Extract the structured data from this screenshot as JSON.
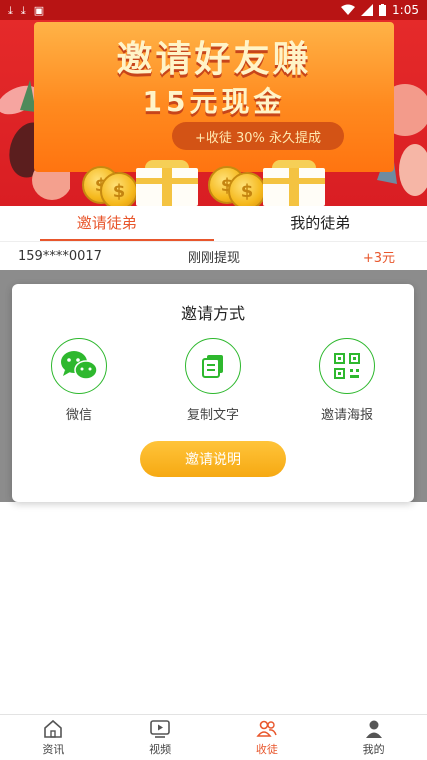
{
  "status_bar": {
    "time": "1:05",
    "left_icons": [
      "download-icon",
      "download-icon",
      "image-icon"
    ],
    "right_icons": [
      "wifi-icon",
      "signal-icon",
      "battery-icon"
    ]
  },
  "banner": {
    "title": "邀请好友赚",
    "subtitle": "15元现金",
    "pill": "+收徒  30%  永久提成",
    "coin_symbol": "$"
  },
  "tabs": [
    {
      "label": "邀请徒弟",
      "active": true
    },
    {
      "label": "我的徒弟",
      "active": false
    }
  ],
  "notice": {
    "phone": "159****0017",
    "text": "刚刚提现",
    "amount": "+3元"
  },
  "dialog": {
    "title": "邀请方式",
    "options": [
      {
        "label": "微信",
        "icon": "wechat-icon"
      },
      {
        "label": "复制文字",
        "icon": "copy-text-icon"
      },
      {
        "label": "邀请海报",
        "icon": "qr-code-icon"
      }
    ],
    "button": "邀请说明"
  },
  "bottom_nav": [
    {
      "label": "资讯",
      "icon": "home-icon",
      "active": false
    },
    {
      "label": "视频",
      "icon": "video-icon",
      "active": false
    },
    {
      "label": "收徒",
      "icon": "people-icon",
      "active": true
    },
    {
      "label": "我的",
      "icon": "user-icon",
      "active": false
    }
  ],
  "colors": {
    "accent": "#e8562c",
    "banner_red": "#d91e23",
    "green": "#2eb82e",
    "button_yellow": "#f6a913"
  }
}
